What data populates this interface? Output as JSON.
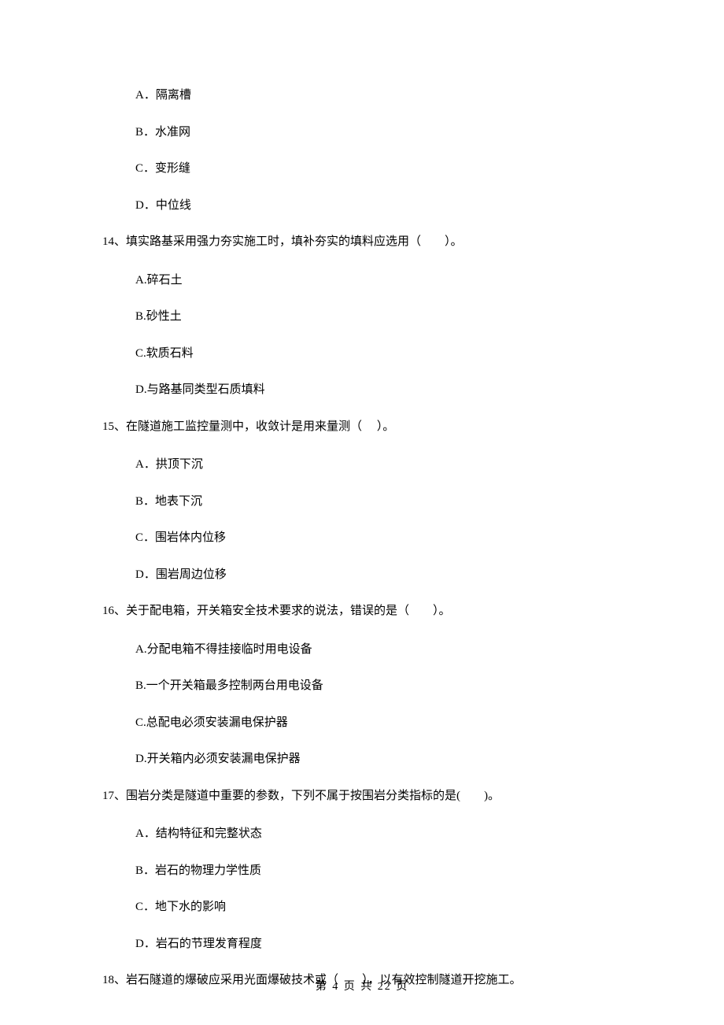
{
  "q13_options": {
    "a": "A．隔离槽",
    "b": "B．水准网",
    "c": "C．变形缝",
    "d": "D．中位线"
  },
  "q14": {
    "text": "14、填实路基采用强力夯实施工时，填补夯实的填料应选用（　　）。",
    "a": "A.碎石土",
    "b": "B.砂性土",
    "c": "C.软质石料",
    "d": "D.与路基同类型石质填料"
  },
  "q15": {
    "text": "15、在隧道施工监控量测中，收敛计是用来量测（　 ）。",
    "a": "A．拱顶下沉",
    "b": "B．地表下沉",
    "c": "C．围岩体内位移",
    "d": "D．围岩周边位移"
  },
  "q16": {
    "text": "16、关于配电箱，开关箱安全技术要求的说法，错误的是（　　）。",
    "a": "A.分配电箱不得挂接临时用电设备",
    "b": "B.一个开关箱最多控制两台用电设备",
    "c": "C.总配电必须安装漏电保护器",
    "d": "D.开关箱内必须安装漏电保护器"
  },
  "q17": {
    "text": "17、围岩分类是隧道中重要的参数，下列不属于按围岩分类指标的是(　　)。",
    "a": "A．结构特征和完整状态",
    "b": "B．岩石的物理力学性质",
    "c": "C．地下水的影响",
    "d": "D．岩石的节理发育程度"
  },
  "q18": {
    "text": "18、岩石隧道的爆破应采用光面爆破技术或（　　），以有效控制隧道开挖施工。"
  },
  "footer": "第 4 页 共 22 页"
}
